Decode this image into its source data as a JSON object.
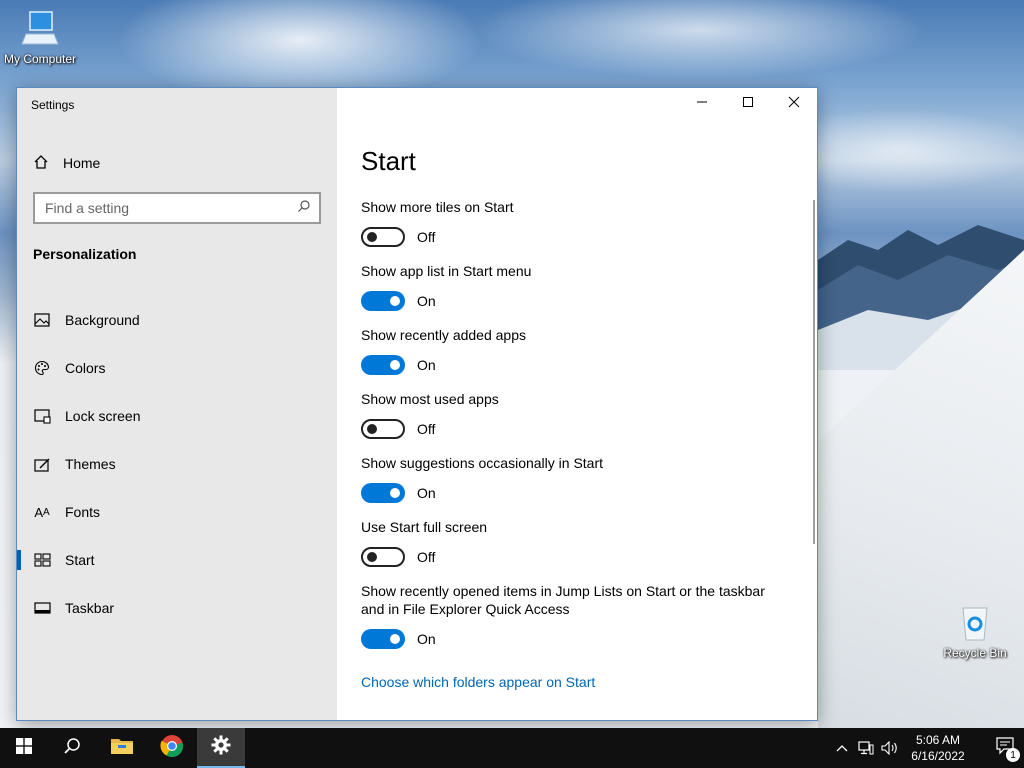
{
  "desktop": {
    "icons": [
      {
        "label": "My Computer"
      },
      {
        "label": "Recycle Bin"
      }
    ]
  },
  "window": {
    "title": "Settings",
    "controls": {
      "minimize": "minimize-icon",
      "maximize": "maximize-icon",
      "close": "close-icon"
    }
  },
  "sidebar": {
    "home_label": "Home",
    "search_placeholder": "Find a setting",
    "section_label": "Personalization",
    "items": [
      {
        "label": "Background",
        "icon": "image-icon"
      },
      {
        "label": "Colors",
        "icon": "palette-icon"
      },
      {
        "label": "Lock screen",
        "icon": "lock-screen-icon"
      },
      {
        "label": "Themes",
        "icon": "themes-icon"
      },
      {
        "label": "Fonts",
        "icon": "fonts-icon"
      },
      {
        "label": "Start",
        "icon": "start-icon",
        "selected": true
      },
      {
        "label": "Taskbar",
        "icon": "taskbar-icon"
      }
    ]
  },
  "main": {
    "title": "Start",
    "settings": [
      {
        "label": "Show more tiles on Start",
        "state": "Off"
      },
      {
        "label": "Show app list in Start menu",
        "state": "On"
      },
      {
        "label": "Show recently added apps",
        "state": "On"
      },
      {
        "label": "Show most used apps",
        "state": "Off"
      },
      {
        "label": "Show suggestions occasionally in Start",
        "state": "On"
      },
      {
        "label": "Use Start full screen",
        "state": "Off"
      },
      {
        "label": "Show recently opened items in Jump Lists on Start or the taskbar and in File Explorer Quick Access",
        "state": "On"
      }
    ],
    "link": "Choose which folders appear on Start"
  },
  "taskbar": {
    "clock_time": "5:06 AM",
    "clock_date": "6/16/2022",
    "notification_count": "1"
  },
  "colors": {
    "accent": "#0078d7",
    "link": "#0066b4",
    "sidebar_bg": "#e8e8e8",
    "taskbar_bg": "#101010"
  }
}
